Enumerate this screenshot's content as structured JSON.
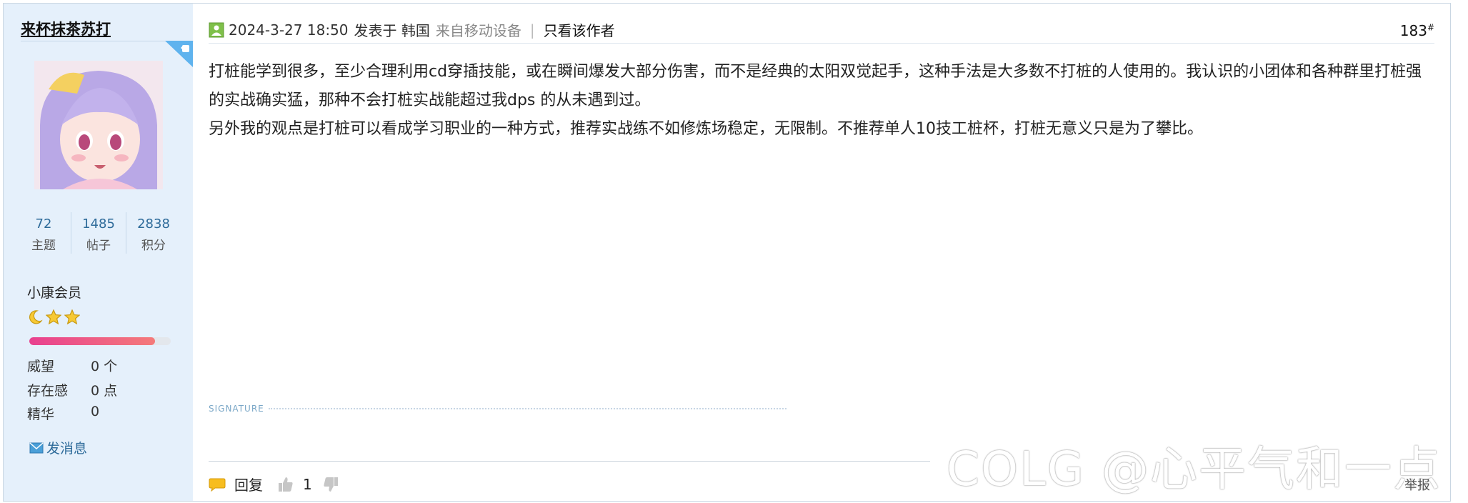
{
  "user": {
    "name": "来杯抹茶苏打",
    "stats": [
      {
        "value": "72",
        "label": "主题"
      },
      {
        "value": "1485",
        "label": "帖子"
      },
      {
        "value": "2838",
        "label": "积分"
      }
    ],
    "group": "小康会员",
    "rank_icons": [
      "moon-icon",
      "star-icon",
      "star-icon"
    ],
    "progress": 0.89,
    "attributes": [
      {
        "label": "威望",
        "value": "0 个"
      },
      {
        "label": "存在感",
        "value": "0 点"
      },
      {
        "label": "精华",
        "value": "0"
      }
    ],
    "message_label": "发消息"
  },
  "post": {
    "date": "2024-3-27 18:50",
    "posted_at_label": "发表于 韩国",
    "device": "来自移动设备",
    "separator": "|",
    "author_only": "只看该作者",
    "floor": "183",
    "floor_mark": "#",
    "paragraphs": [
      "打桩能学到很多，至少合理利用cd穿插技能，或在瞬间爆发大部分伤害，而不是经典的太阳双觉起手，这种手法是大多数不打桩的人使用的。我认识的小团体和各种群里打桩强的实战确实猛，那种不会打桩实战能超过我dps 的从未遇到过。",
      "另外我的观点是打桩可以看成学习职业的一种方式，推荐实战练不如修炼场稳定，无限制。不推荐单人10技工桩杯，打桩无意义只是为了攀比。"
    ],
    "signature_label": "SIGNATURE"
  },
  "footer": {
    "reply": "回复",
    "like_count": "1",
    "report": "举报"
  },
  "watermark": "COLG @心平气和一点",
  "colors": {
    "sidebar_bg": "#e5f0fb",
    "link_blue": "#2e6b9a",
    "progress_pink": "#e8408f"
  }
}
